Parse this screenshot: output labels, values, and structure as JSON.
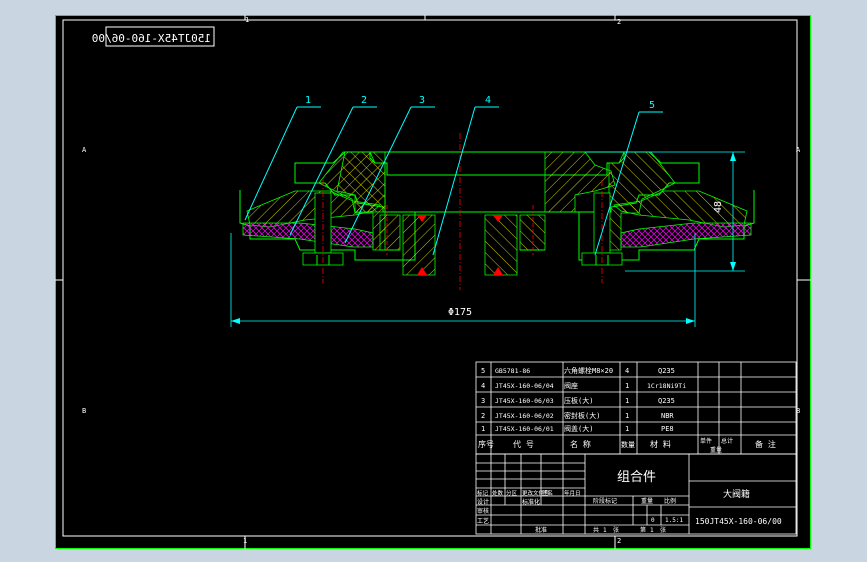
{
  "drawing": {
    "number_mirrored": "150JT45X-160-06/00",
    "zone_columns": [
      "1",
      "2"
    ],
    "zone_rows": [
      "A",
      "B"
    ],
    "balloons": [
      "1",
      "2",
      "3",
      "4",
      "5"
    ],
    "dimension_height": "48",
    "dimension_diameter": "Φ175"
  },
  "bom": {
    "rows": [
      {
        "no": "5",
        "code": "GB5781-86",
        "name": "六角螺栓M8×20",
        "qty": "4",
        "material": "Q235"
      },
      {
        "no": "4",
        "code": "JT45X-160-06/04",
        "name": "阀座",
        "qty": "1",
        "material": "1Cr18Ni9Ti"
      },
      {
        "no": "3",
        "code": "JT45X-160-06/03",
        "name": "压板(大)",
        "qty": "1",
        "material": "Q235"
      },
      {
        "no": "2",
        "code": "JT45X-160-06/02",
        "name": "密封板(大)",
        "qty": "1",
        "material": "NBR"
      },
      {
        "no": "1",
        "code": "JT45X-160-06/01",
        "name": "阀盖(大)",
        "qty": "1",
        "material": "PE8"
      }
    ],
    "headers": {
      "no": "序号",
      "code": "代 号",
      "name": "名 称",
      "qty": "数量",
      "material": "材 料",
      "unit": "单件",
      "total": "总计",
      "weight": "重量",
      "note": "备 注"
    }
  },
  "title_block": {
    "assembly_name": "组合件",
    "product": "大阀籍",
    "drawing_number": "150JT45X-160-06/00",
    "labels": {
      "mark": "标记",
      "count": "处数",
      "zone": "分区",
      "doc": "更改文件号",
      "sign": "签名",
      "date": "年月日",
      "design": "设计",
      "standard": "标准化",
      "audit": "审核",
      "process": "工艺",
      "approve": "批准",
      "stage": "阶段标记",
      "weight": "重量",
      "scale": "比例",
      "sheet_total": "共",
      "sheet": "张",
      "sheet_no": "第"
    },
    "scale": "1.5:1",
    "weight": "0",
    "sheets": "1"
  },
  "colors": {
    "frame": "#ffffff",
    "geometry": "#00ff00",
    "dimensions": "#00ffff",
    "centerline": "#ff0000",
    "hatch_main": "#ffff00",
    "hatch_seal": "#ff00ff",
    "background": "#000000"
  }
}
